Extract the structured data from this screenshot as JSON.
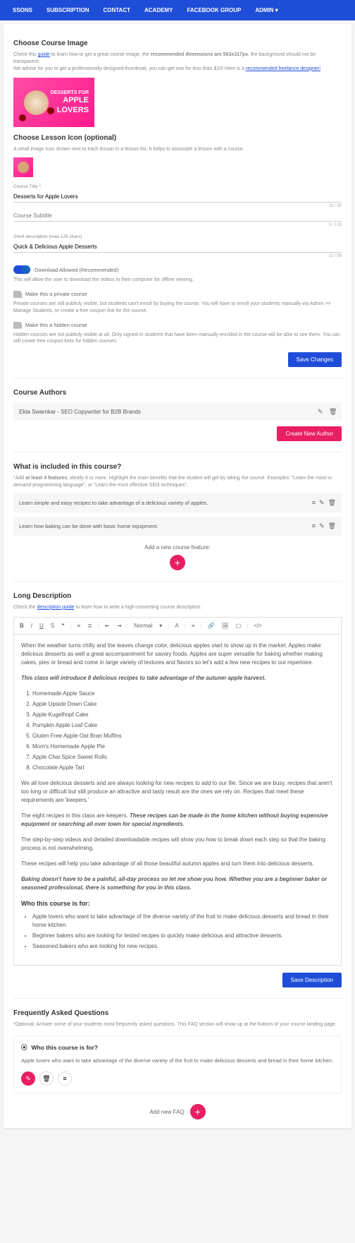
{
  "nav": [
    "SSONS",
    "SUBSCRIPTION",
    "CONTACT",
    "ACADEMY",
    "FACEBOOK GROUP",
    "ADMIN ▾"
  ],
  "img": {
    "title": "Choose Course Image",
    "help1a": "Check this ",
    "help1link": "guide",
    "help1b": " to learn how to get a great course image, the ",
    "help1bold": "recommended dimensions are 563x317px",
    "help1c": ", the background should not be transparent.",
    "help2a": "We advise for you to get a professionally designed thumbnail, you can get one for less than $10! Here is a ",
    "help2link": "recommended freelance designer!",
    "thumbLine1": "DESSERTS FOR",
    "thumbLine2": "APPLE",
    "thumbLine3": "LOVERS"
  },
  "icon": {
    "title": "Choose Lesson Icon (optional)",
    "help": "A small image icon shown next to each lesson in a lesson list. It helps to associate a lesson with a course."
  },
  "fields": {
    "titleLabel": "Course Title *",
    "titleVal": "Desserts for Apple Lovers",
    "titleCount": "25 / 60",
    "subtitleVal": "Course Subtitle",
    "subtitleCount": "0 / 125",
    "shortLabel": "Short description (max 125 chars)",
    "shortVal": "Quick & Delicious Apple Desserts",
    "shortCount": "32 / 99"
  },
  "toggles": {
    "download": "Download Allowed (Recommended)",
    "downloadHelp": "This will allow the user to download the videos to their computer for offline viewing.",
    "private": "Make this a private course",
    "privateHelp": "Private courses are still publicly visible, but students can't enroll by buying the course. You will have to enroll your students manually via Admin >> Manage Students, or create a free coupon link for the course.",
    "hidden": "Make this a hidden course",
    "hiddenHelp": "Hidden courses are not publicly visible at all. Only signed-in students that have been manually enrolled in the course will be able to see them. You can still create free coupon links for hidden courses."
  },
  "buttons": {
    "save": "Save Changes",
    "newAuthor": "Create New Author",
    "saveDesc": "Save Description"
  },
  "authors": {
    "title": "Course Authors",
    "name": "Ekta Swarnkar - SEO Copywriter for B2B Brands"
  },
  "features": {
    "title": "What is included in this course?",
    "help1": "*Add ",
    "helpBold": "at least 4 features",
    "help2": ", ideally 6 or more. Highlight the main benefits that the student will get by taking the course. Examples: \"Learn the most in-demand programming language\", or \"Learn the most effective SEO techniques\".",
    "f1": "Learn simple and easy recipes to take advantage of a delicious variety of apples.",
    "f2": "Learn how baking can be done with basic home equipment.",
    "add": "Add a new course feature:"
  },
  "desc": {
    "title": "Long Description",
    "helpA": "Check the ",
    "helpLink": "description guide",
    "helpB": " to learn how to write a high-converting course description.",
    "normal": "Normal",
    "p1": "When the weather turns chilly and the leaves change color, delicious apples start to show up in the market. Apples make delicious desserts as well a great accompaniment for savory foods. Apples are super versatile for baking whether making cakes, pies or bread and come in large variety of textures and flavors so let's add a few new recipes to our repertoire.",
    "p2": "This class will introduce 8 delicious recipes to take advantage of the autumn apple harvest.",
    "r1": "Homemade Apple Sauce",
    "r2": "Apple Upside Down Cake",
    "r3": "Apple Kugelhopf Cake",
    "r4": "Pumpkin Apple Loaf Cake",
    "r5": "Gluten Free Apple Oat Bran Muffins",
    "r6": "Mom's Homemade Apple Pie",
    "r7": "Apple Chai Spice Sweet Rolls",
    "r8": "Chocolate Apple Tart",
    "p3": "We all love delicious desserts and are always looking for new recipes to add to our file. Since we are busy, recipes that aren't too long or difficult but still produce an attractive and tasty result are the ones we rely on. Recipes that meet these requirements are 'keepers.'",
    "p4a": "The eight recipes in this class are keepers. ",
    "p4b": "These recipes can be made in the home kitchen without buying expensive equipment or searching all over town for special ingredients.",
    "p5": "The step-by-step videos and detailed downloadable recipes will show you how to break down each step so that the baking process is not overwhelming.",
    "p6": "These recipes will help you take advantage of all those beautiful autumn apples and turn them into delicious desserts.",
    "p7": "Baking doesn't have to be a painful, all-day process so let me show you how. Whether you are a beginner baker or seasoned professional, there is something for you in this class.",
    "who": "Who this course is for:",
    "b1": "Apple lovers who want to take advantage of the diverse variety of the fruit to make delicious desserts and bread in their home kitchen.",
    "b2": "Beginner bakers who are looking for tested recipes to quickly make delicious and attractive desserts.",
    "b3": "Seasoned bakers who are looking for new recipes."
  },
  "faq": {
    "title": "Frequently Asked Questions",
    "help": "*Optional: Answer some of your students most frequently asked questions. This FAQ section will show up at the bottom of your course landing page.",
    "q1": "Who this course is for?",
    "a1": "Apple lovers who want to take advantage of the diverse variety of the fruit to make delicious desserts and bread in their home kitchen.",
    "add": "Add new FAQ"
  }
}
